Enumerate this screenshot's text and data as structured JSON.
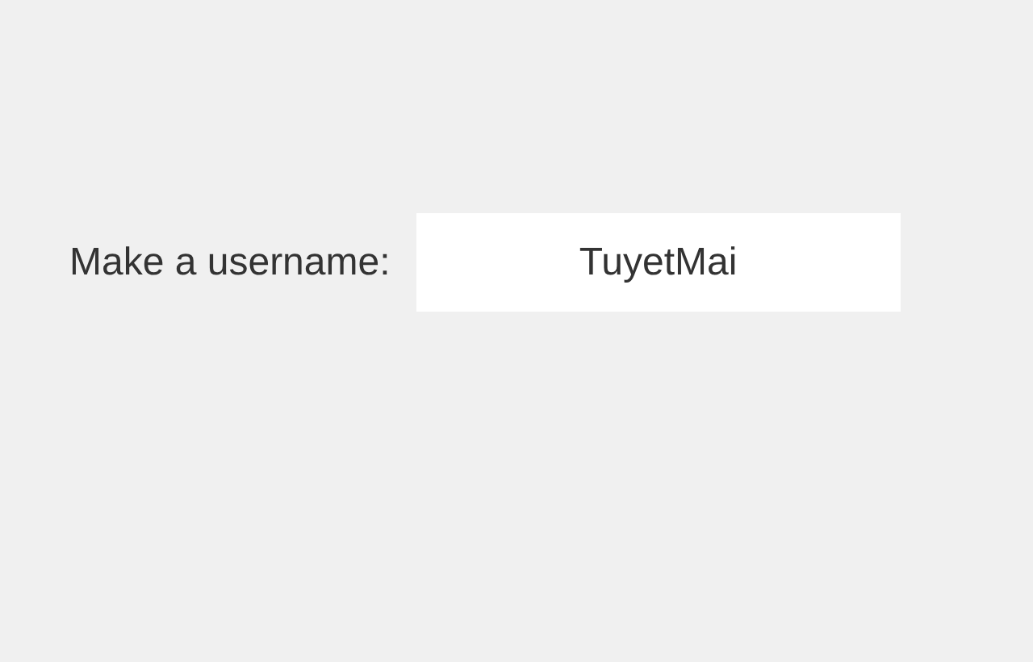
{
  "form": {
    "label": "Make a username:",
    "username": {
      "value": "TuyetMai"
    }
  }
}
